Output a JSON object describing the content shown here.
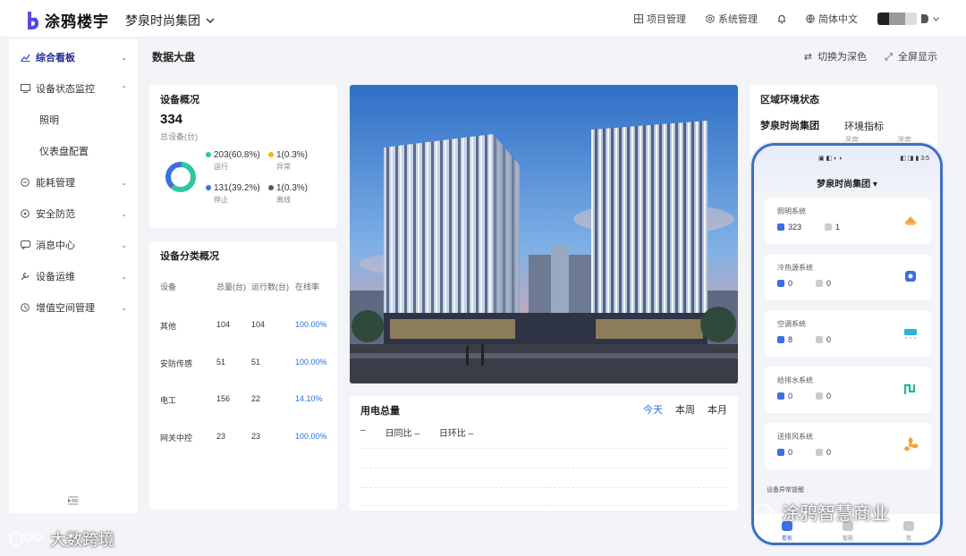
{
  "brand": {
    "name": "涂鸦楼宇"
  },
  "header": {
    "group": "梦泉时尚集团",
    "items": [
      {
        "label": "项目管理",
        "icon": "grid-icon"
      },
      {
        "label": "系统管理",
        "icon": "gear-icon"
      },
      {
        "label": "",
        "icon": "bell-icon"
      },
      {
        "label": "简体中文",
        "icon": "globe-icon"
      }
    ]
  },
  "sidebar": {
    "items": [
      {
        "label": "综合看板",
        "icon": "chart-icon",
        "active": true
      },
      {
        "label": "设备状态监控",
        "icon": "monitor-icon"
      },
      {
        "label": "照明",
        "sub": true
      },
      {
        "label": "仪表盘配置",
        "sub": true
      },
      {
        "label": "能耗管理",
        "icon": "energy-icon"
      },
      {
        "label": "安全防范",
        "icon": "shield-icon"
      },
      {
        "label": "消息中心",
        "icon": "message-icon"
      },
      {
        "label": "设备运维",
        "icon": "wrench-icon"
      },
      {
        "label": "增值空间管理",
        "icon": "space-icon"
      }
    ]
  },
  "page": {
    "title": "数据大盘",
    "toggle_dark": "切换为深色",
    "fullscreen": "全屏显示"
  },
  "overview": {
    "title": "设备概况",
    "total": "334",
    "total_label": "总设备(台)",
    "stats": [
      {
        "value": "203(60.8%)",
        "label": "运行",
        "color": "#2fc7a0",
        "fraction": 0.608
      },
      {
        "value": "1(0.3%)",
        "label": "异常",
        "color": "#f5b800",
        "fraction": 0.003
      },
      {
        "value": "131(39.2%)",
        "label": "停止",
        "color": "#3b6fe6",
        "fraction": 0.392
      },
      {
        "value": "1(0.3%)",
        "label": "离线",
        "color": "#4a5a78",
        "fraction": 0.003
      }
    ]
  },
  "category": {
    "title": "设备分类概况",
    "headers": [
      "设备",
      "总量(台)",
      "运行数(台)",
      "在线率"
    ],
    "rows": [
      {
        "name": "其他",
        "total": "104",
        "running": "104",
        "rate": "100.00%"
      },
      {
        "name": "安防传感",
        "total": "51",
        "running": "51",
        "rate": "100.00%"
      },
      {
        "name": "电工",
        "total": "156",
        "running": "22",
        "rate": "14.10%"
      },
      {
        "name": "网关中控",
        "total": "23",
        "running": "23",
        "rate": "100.00%"
      }
    ]
  },
  "power": {
    "title": "用电总量",
    "tabs": [
      "今天",
      "周",
      "月"
    ],
    "tabs_full": [
      "今天",
      "本周",
      "本月"
    ],
    "dash": "–",
    "yoy": "日同比 –",
    "mom": "日环比 –"
  },
  "region": {
    "title": "区域环境状态",
    "group": "梦泉时尚集团",
    "env": "环境指标",
    "mini1": "温度",
    "mini2": "湿度"
  },
  "phone": {
    "status_left": "▣ ◧ ◐ ◐",
    "status_right": "◧ ◨ ▮ 3:5",
    "title": "梦泉时尚集团 ▾",
    "systems": [
      {
        "name": "照明系统",
        "on": "323",
        "off": "1",
        "icon": "lamp-icon",
        "color": "#f2a43a"
      },
      {
        "name": "冷热源系统",
        "on": "0",
        "off": "0",
        "icon": "hvac-source-icon",
        "color": "#3b6fe6"
      },
      {
        "name": "空调系统",
        "on": "8",
        "off": "0",
        "icon": "air-conditioner-icon",
        "color": "#29b6d8"
      },
      {
        "name": "给排水系统",
        "on": "0",
        "off": "0",
        "icon": "water-pipe-icon",
        "color": "#1fb79a"
      },
      {
        "name": "送排风系统",
        "on": "0",
        "off": "0",
        "icon": "fan-icon",
        "color": "#f2a43a"
      }
    ],
    "alert": "设备异常提醒",
    "nav": [
      "看板",
      "智能",
      "我"
    ]
  },
  "watermarks": {
    "right": "涂鸦智慧商业",
    "left": "大数跨境"
  }
}
